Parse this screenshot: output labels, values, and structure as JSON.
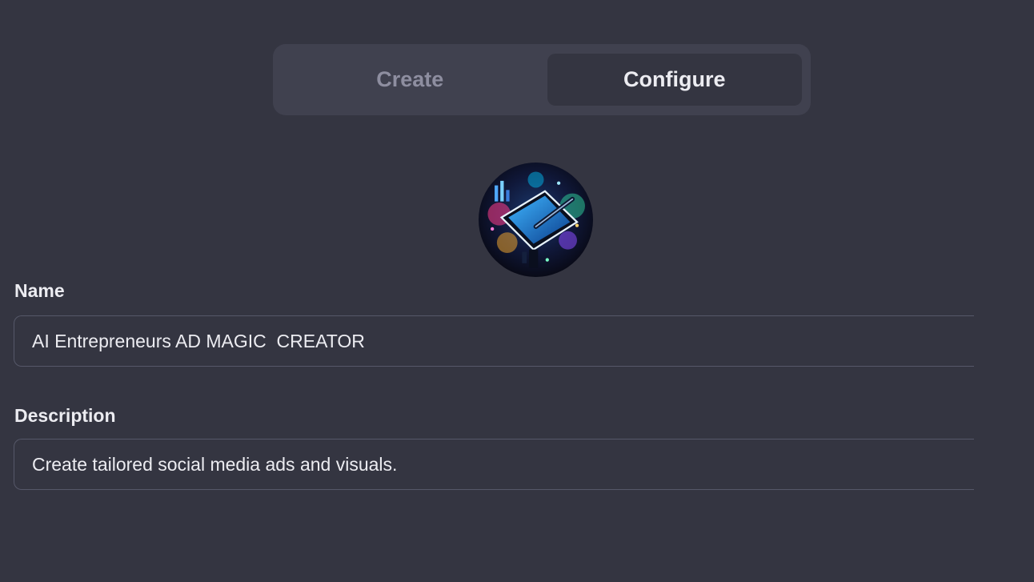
{
  "tabs": [
    {
      "label": "Create",
      "active": false
    },
    {
      "label": "Configure",
      "active": true
    }
  ],
  "avatar": {
    "icon": "gpt-avatar-image",
    "depicts": "digital tablet with stylus"
  },
  "fields": {
    "name": {
      "label": "Name",
      "value": "AI Entrepreneurs AD MAGIC  CREATOR"
    },
    "description": {
      "label": "Description",
      "value": "Create tailored social media ads and visuals."
    }
  },
  "colors": {
    "background": "#343541",
    "tab_bar": "#40414f",
    "text": "#ececf1",
    "muted_text": "#8e8ea0",
    "border": "#565869"
  }
}
